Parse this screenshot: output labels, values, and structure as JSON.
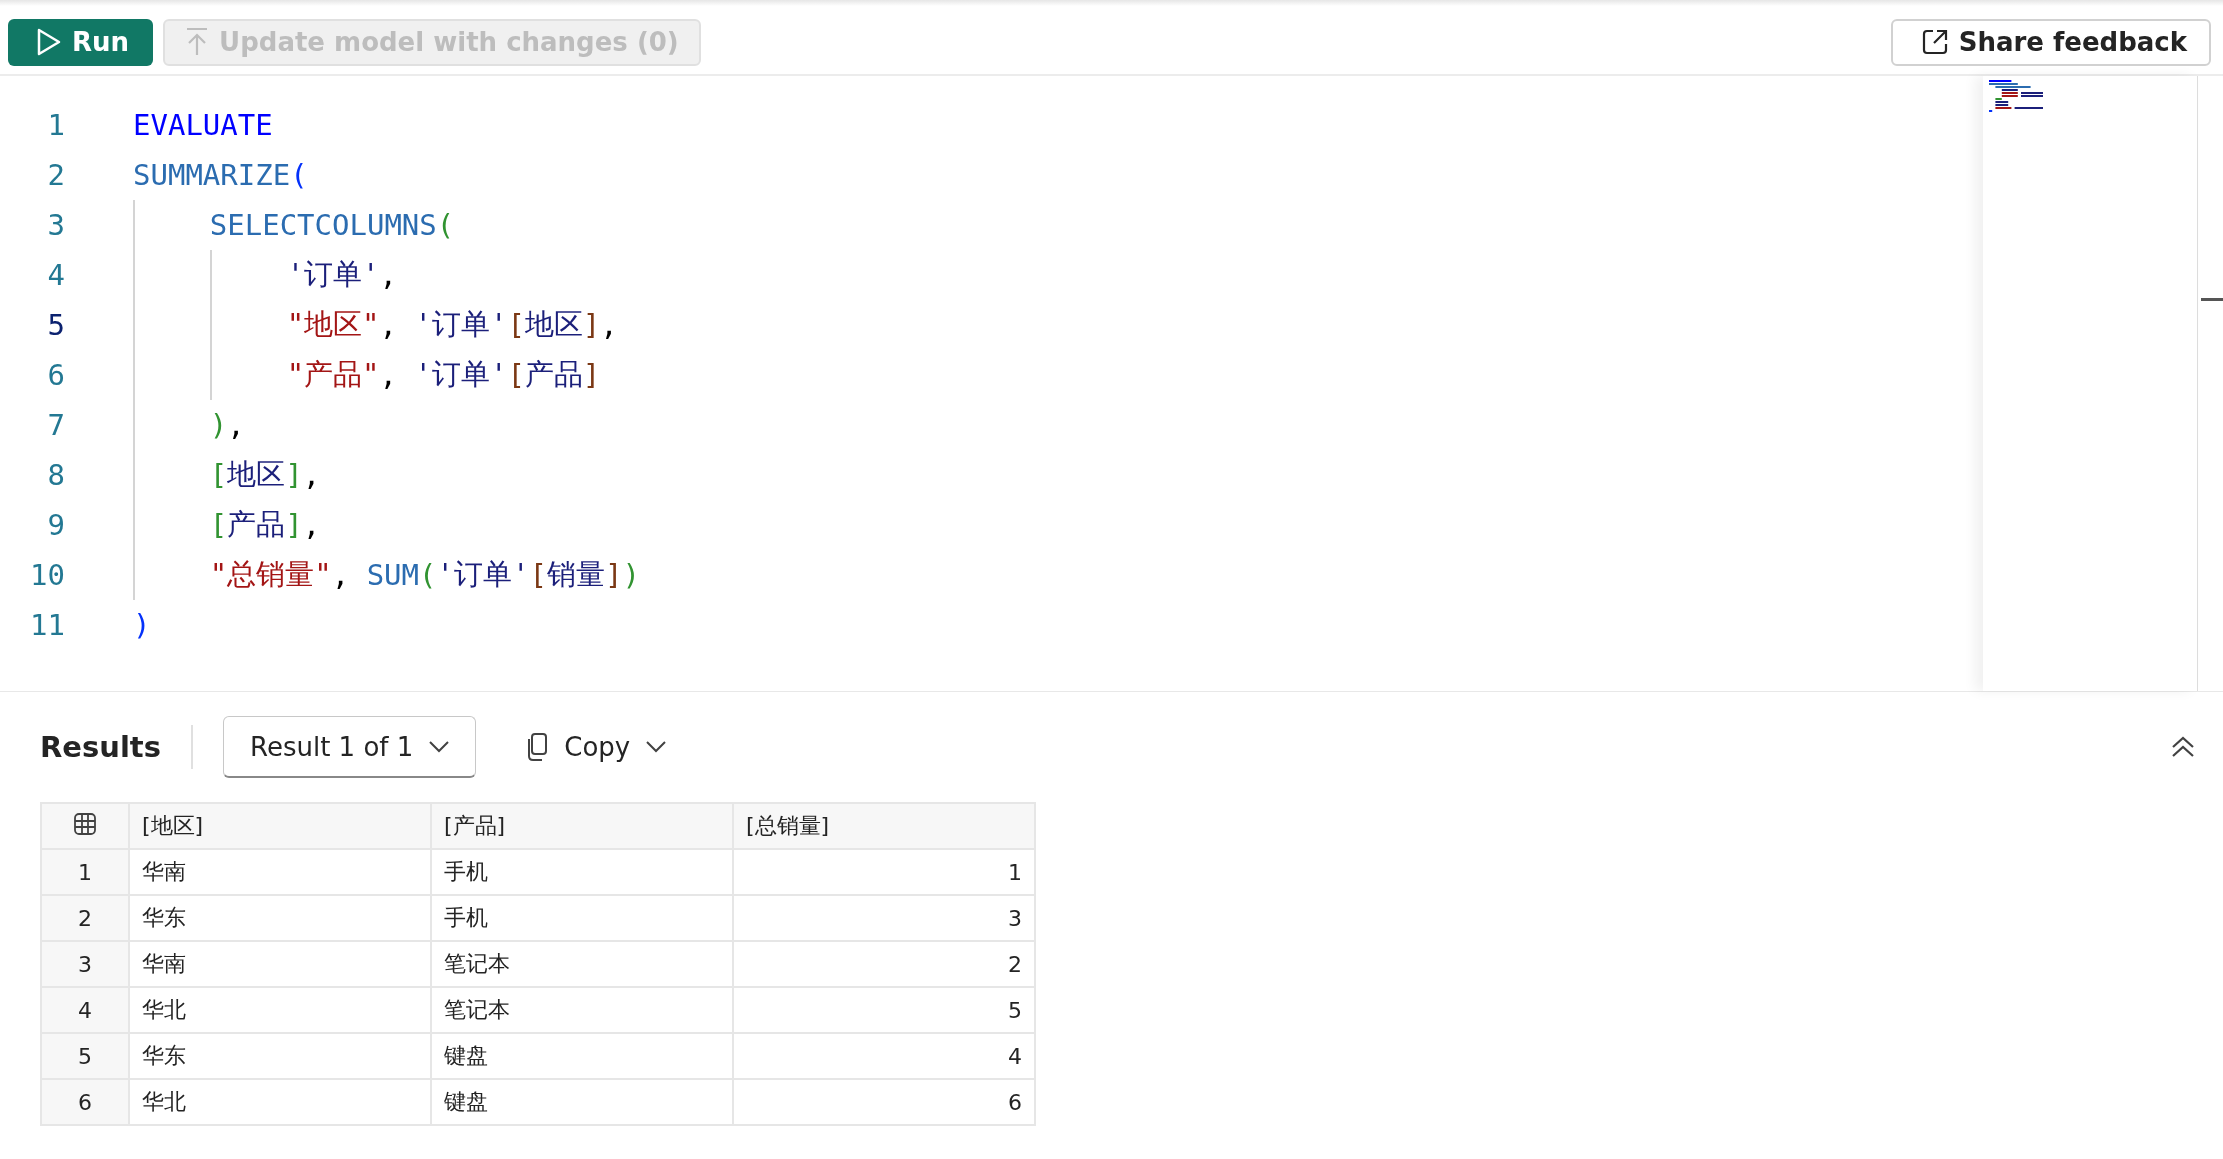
{
  "toolbar": {
    "run_button": {
      "label": "Run"
    },
    "update_button": {
      "label": "Update model with changes (0)",
      "disabled": true
    },
    "share_button": {
      "label": "Share feedback"
    }
  },
  "editor": {
    "lines": [
      {
        "number": "1",
        "current": false,
        "tokens": [
          {
            "kind": "keyword",
            "text": "EVALUATE"
          }
        ]
      },
      {
        "number": "2",
        "current": false,
        "tokens": [
          {
            "kind": "function",
            "text": "SUMMARIZE"
          },
          {
            "kind": "bracket1",
            "text": "("
          }
        ],
        "children": [
          {
            "number": "3",
            "current": false,
            "tokens": [
              {
                "kind": "function",
                "text": "SELECTCOLUMNS"
              },
              {
                "kind": "bracket2",
                "text": "("
              }
            ],
            "children": [
              {
                "number": "4",
                "current": false,
                "tokens": [
                  {
                    "kind": "table",
                    "text": "'订单'"
                  },
                  {
                    "kind": "punct",
                    "text": ","
                  }
                ]
              },
              {
                "number": "5",
                "current": true,
                "tokens": [
                  {
                    "kind": "string",
                    "text": "\"地区\""
                  },
                  {
                    "kind": "punct",
                    "text": ", "
                  },
                  {
                    "kind": "table",
                    "text": "'订单'"
                  },
                  {
                    "kind": "bracket3",
                    "text": "["
                  },
                  {
                    "kind": "column",
                    "text": "地区"
                  },
                  {
                    "kind": "bracket3",
                    "text": "]"
                  },
                  {
                    "kind": "punct",
                    "text": ","
                  }
                ]
              },
              {
                "number": "6",
                "current": false,
                "tokens": [
                  {
                    "kind": "string",
                    "text": "\"产品\""
                  },
                  {
                    "kind": "punct",
                    "text": ", "
                  },
                  {
                    "kind": "table",
                    "text": "'订单'"
                  },
                  {
                    "kind": "bracket3",
                    "text": "["
                  },
                  {
                    "kind": "column",
                    "text": "产品"
                  },
                  {
                    "kind": "bracket3",
                    "text": "]"
                  }
                ]
              }
            ]
          },
          {
            "number": "7",
            "current": false,
            "tokens": [
              {
                "kind": "bracket2",
                "text": ")"
              },
              {
                "kind": "punct",
                "text": ","
              }
            ]
          },
          {
            "number": "8",
            "current": false,
            "tokens": [
              {
                "kind": "bracket2",
                "text": "["
              },
              {
                "kind": "column",
                "text": "地区"
              },
              {
                "kind": "bracket2",
                "text": "]"
              },
              {
                "kind": "punct",
                "text": ","
              }
            ]
          },
          {
            "number": "9",
            "current": false,
            "tokens": [
              {
                "kind": "bracket2",
                "text": "["
              },
              {
                "kind": "column",
                "text": "产品"
              },
              {
                "kind": "bracket2",
                "text": "]"
              },
              {
                "kind": "punct",
                "text": ","
              }
            ]
          },
          {
            "number": "10",
            "current": false,
            "tokens": [
              {
                "kind": "string",
                "text": "\"总销量\""
              },
              {
                "kind": "punct",
                "text": ", "
              },
              {
                "kind": "function",
                "text": "SUM"
              },
              {
                "kind": "bracket2",
                "text": "("
              },
              {
                "kind": "table",
                "text": "'订单'"
              },
              {
                "kind": "bracket3",
                "text": "["
              },
              {
                "kind": "column",
                "text": "销量"
              },
              {
                "kind": "bracket3",
                "text": "]"
              },
              {
                "kind": "bracket2",
                "text": ")"
              }
            ]
          }
        ]
      },
      {
        "number": "11",
        "current": false,
        "tokens": [
          {
            "kind": "bracket1",
            "text": ")"
          }
        ]
      }
    ]
  },
  "results": {
    "title": "Results",
    "result_selector": "Result 1 of 1",
    "copy_button": "Copy",
    "table": {
      "columns": [
        {
          "label": "[地区]",
          "kind": "text"
        },
        {
          "label": "[产品]",
          "kind": "text"
        },
        {
          "label": "[总销量]",
          "kind": "number"
        }
      ],
      "rows": [
        {
          "index": "1",
          "cells": [
            "华南",
            "手机",
            "1"
          ]
        },
        {
          "index": "2",
          "cells": [
            "华东",
            "手机",
            "3"
          ]
        },
        {
          "index": "3",
          "cells": [
            "华南",
            "笔记本",
            "2"
          ]
        },
        {
          "index": "4",
          "cells": [
            "华北",
            "笔记本",
            "5"
          ]
        },
        {
          "index": "5",
          "cells": [
            "华东",
            "键盘",
            "4"
          ]
        },
        {
          "index": "6",
          "cells": [
            "华北",
            "键盘",
            "6"
          ]
        }
      ]
    }
  }
}
